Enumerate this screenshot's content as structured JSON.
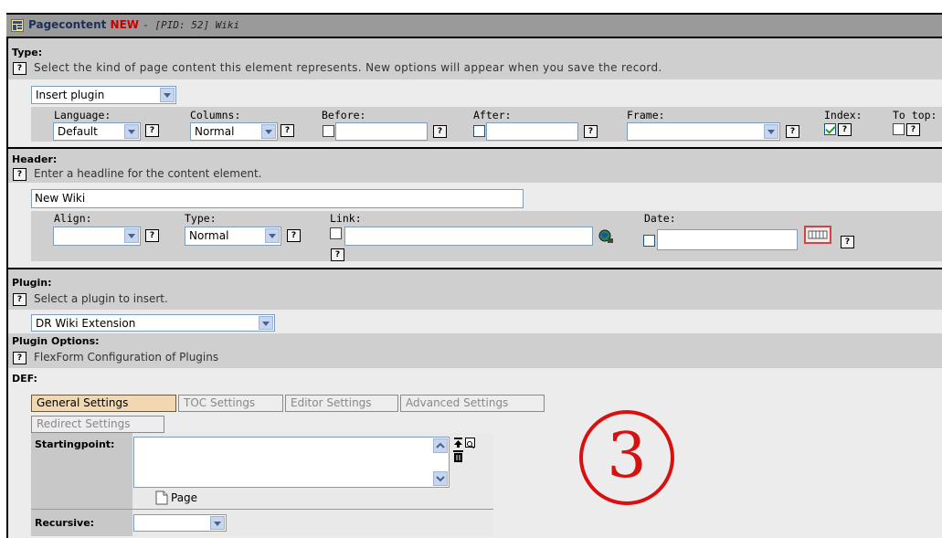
{
  "window": {
    "title_main": "Pagecontent",
    "title_new": "NEW",
    "title_rest": "- [PID: 52] Wiki"
  },
  "type_section": {
    "heading": "Type:",
    "help_text": "Select the kind of page content this element represents. New options will appear when you save the record.",
    "type_select": "Insert plugin",
    "fields": {
      "language_label": "Language:",
      "language_value": "Default",
      "columns_label": "Columns:",
      "columns_value": "Normal",
      "before_label": "Before:",
      "after_label": "After:",
      "frame_label": "Frame:",
      "frame_value": "",
      "index_label": "Index:",
      "index_checked": true,
      "totop_label": "To top:",
      "totop_checked": false
    }
  },
  "header_section": {
    "heading": "Header:",
    "help_text": "Enter a headline for the content element.",
    "header_value": "New Wiki",
    "fields": {
      "align_label": "Align:",
      "align_value": "",
      "type_label": "Type:",
      "type_value": "Normal",
      "link_label": "Link:",
      "link_value": "",
      "date_label": "Date:",
      "date_value": ""
    }
  },
  "plugin_section": {
    "heading": "Plugin:",
    "help_text": "Select a plugin to insert.",
    "plugin_value": "DR Wiki Extension",
    "options_heading": "Plugin Options:",
    "options_help": "FlexForm Configuration of Plugins",
    "def_label": "DEF:",
    "tabs": [
      {
        "label": "General Settings",
        "active": true
      },
      {
        "label": "TOC Settings",
        "active": false
      },
      {
        "label": "Editor Settings",
        "active": false
      },
      {
        "label": "Advanced Settings",
        "active": false
      },
      {
        "label": "Redirect Settings",
        "active": false
      }
    ],
    "startingpoint_label": "Startingpoint:",
    "page_label": "Page",
    "recursive_label": "Recursive:",
    "recursive_value": ""
  },
  "annotation": {
    "label": "③",
    "color": "#d81010"
  },
  "help_glyph": "?"
}
